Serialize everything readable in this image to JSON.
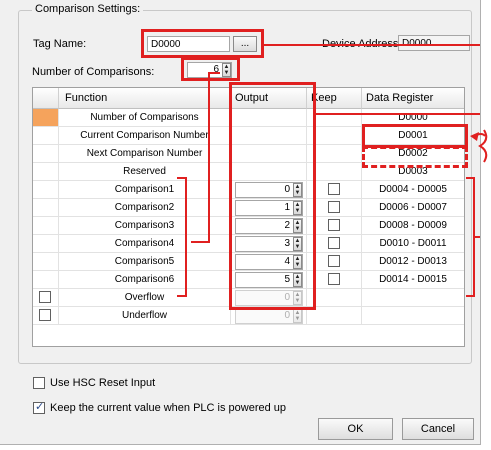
{
  "settings": {
    "group_title": "Comparison Settings:",
    "tag_label": "Tag Name:",
    "tag_value": "D0000",
    "browse_label": "...",
    "device_address_label": "Device Address:",
    "device_address_value": "D0000",
    "num_comparisons_label": "Number of Comparisons:",
    "num_comparisons_value": "6"
  },
  "table": {
    "headers": [
      "Function",
      "Output",
      "Keep",
      "Data Register"
    ],
    "rows": [
      {
        "function": "Number of Comparisons",
        "output": "",
        "keep": false,
        "register": "D0000",
        "has_output": false,
        "has_keep": false
      },
      {
        "function": "Current Comparison Number",
        "output": "",
        "keep": false,
        "register": "D0001",
        "has_output": false,
        "has_keep": false
      },
      {
        "function": "Next Comparison Number",
        "output": "",
        "keep": false,
        "register": "D0002",
        "has_output": false,
        "has_keep": false
      },
      {
        "function": "Reserved",
        "output": "",
        "keep": false,
        "register": "D0003",
        "has_output": false,
        "has_keep": false
      },
      {
        "function": "Comparison1",
        "output": "0",
        "keep": false,
        "register": "D0004 - D0005",
        "has_output": true,
        "has_keep": true
      },
      {
        "function": "Comparison2",
        "output": "1",
        "keep": false,
        "register": "D0006 - D0007",
        "has_output": true,
        "has_keep": true
      },
      {
        "function": "Comparison3",
        "output": "2",
        "keep": false,
        "register": "D0008 - D0009",
        "has_output": true,
        "has_keep": true
      },
      {
        "function": "Comparison4",
        "output": "3",
        "keep": false,
        "register": "D0010 - D0011",
        "has_output": true,
        "has_keep": true
      },
      {
        "function": "Comparison5",
        "output": "4",
        "keep": false,
        "register": "D0012 - D0013",
        "has_output": true,
        "has_keep": true
      },
      {
        "function": "Comparison6",
        "output": "5",
        "keep": false,
        "register": "D0014 - D0015",
        "has_output": true,
        "has_keep": true
      },
      {
        "function": "Overflow",
        "output": "0",
        "keep": false,
        "register": "",
        "has_output": true,
        "has_keep": false,
        "disabled": true,
        "row_check": true
      },
      {
        "function": "Underflow",
        "output": "0",
        "keep": false,
        "register": "",
        "has_output": true,
        "has_keep": false,
        "disabled": true,
        "row_check": true
      }
    ]
  },
  "options": {
    "use_hsc_reset_label": "Use HSC Reset Input",
    "use_hsc_reset_checked": false,
    "keep_current_label": "Keep the current value when PLC is powered up",
    "keep_current_checked": true
  },
  "buttons": {
    "ok": "OK",
    "cancel": "Cancel"
  },
  "colors": {
    "annotation": "#e02020",
    "selected_row_marker": "#f5a35c"
  }
}
